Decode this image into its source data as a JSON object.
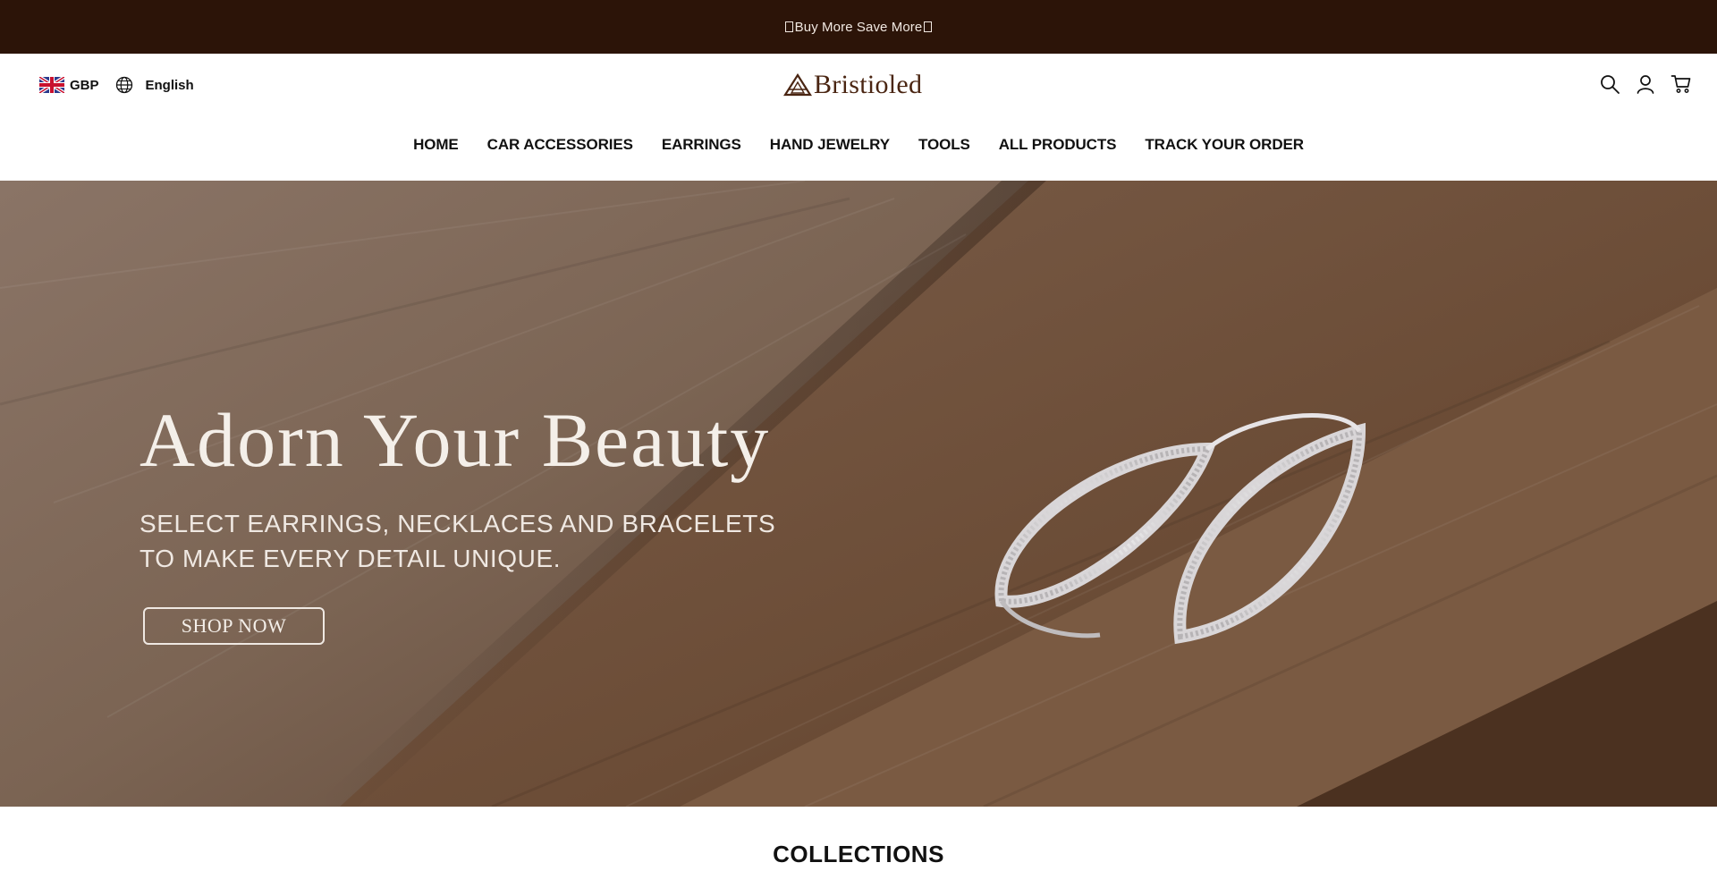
{
  "announcement": {
    "text": "Buy More Save More"
  },
  "locale": {
    "currency": "GBP",
    "language": "English"
  },
  "brand": {
    "name": "Bristioled",
    "color": "#4a2512"
  },
  "icons": {
    "flag": "uk-flag-icon",
    "language": "globe-icon",
    "search": "search-icon",
    "account": "user-icon",
    "cart": "cart-icon"
  },
  "nav": {
    "items": [
      {
        "label": "HOME"
      },
      {
        "label": "CAR ACCESSORIES"
      },
      {
        "label": "EARRINGS"
      },
      {
        "label": "HAND JEWELRY"
      },
      {
        "label": "TOOLS"
      },
      {
        "label": "ALL PRODUCTS"
      },
      {
        "label": "TRACK YOUR ORDER"
      }
    ]
  },
  "hero": {
    "title": "Adorn Your Beauty",
    "subtitle_line1": "SELECT EARRINGS, NECKLACES AND BRACELETS",
    "subtitle_line2": "TO MAKE EVERY DETAIL UNIQUE.",
    "cta": "SHOP NOW"
  },
  "sections": {
    "collections_title": "COLLECTIONS"
  },
  "colors": {
    "announcement_bg": "#2c1408",
    "announcement_text": "#f1e8e1",
    "hero_text": "#f4efe9"
  }
}
